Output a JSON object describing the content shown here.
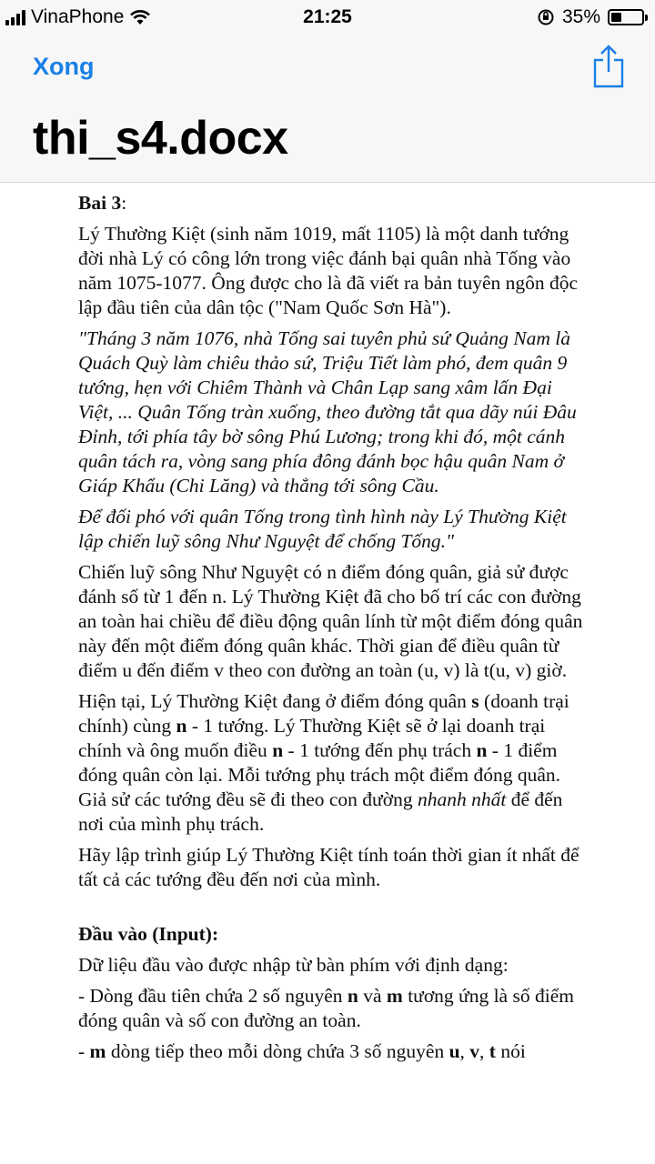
{
  "status_bar": {
    "carrier": "VinaPhone",
    "time": "21:25",
    "battery": "35%",
    "battery_level": 0.35
  },
  "nav": {
    "done_label": "Xong",
    "title": "thi_s4.docx"
  },
  "document": {
    "heading": "Bai 3",
    "heading_suffix": ":",
    "intro": "Lý Thường Kiệt (sinh năm 1019, mất 1105) là một danh tướng đời nhà Lý có công lớn trong việc đánh bại quân nhà Tống vào năm 1075-1077. Ông được cho là đã viết ra bản tuyên ngôn độc lập đầu tiên của dân tộc (\"Nam Quốc Sơn Hà\").",
    "quote1": "\"Tháng 3 năm 1076, nhà Tống sai tuyên phủ sứ Quảng Nam là Quách Quỳ làm chiêu thảo sứ, Triệu Tiết làm phó, đem quân 9 tướng, hẹn với Chiêm Thành và Chân Lạp sang xâm lấn Đại Việt, ... Quân Tống tràn xuống, theo đường tắt qua dãy núi Đâu Đỉnh, tới phía tây bờ sông Phú Lương; trong khi đó, một cánh quân tách ra, vòng sang phía đông đánh bọc hậu quân Nam ở Giáp Khẩu (Chi Lăng) và thẳng tới sông Cầu.",
    "quote2": "Để đối phó với quân Tống trong tình hình này Lý Thường Kiệt lập chiến luỹ sông Như Nguyệt để chống Tống.\"",
    "para_roads": "Chiến luỹ sông Như Nguyệt có n điểm đóng quân, giả sử được đánh số từ 1 đến n. Lý Thường Kiệt đã cho bố trí các con đường an toàn hai chiều để điều động quân lính từ một điểm đóng quân này đến một điểm đóng quân khác. Thời gian để điều quân từ điểm u đến điểm v theo con đường an toàn (u, v) là t(u, v) giờ.",
    "para_generals": {
      "t1": "Hiện tại, Lý Thường Kiệt đang ở điểm đóng quân ",
      "b1": "s",
      "t2": " (doanh trại chính) cùng ",
      "b2": "n",
      "t3": " - 1 tướng. Lý Thường Kiệt sẽ ở lại doanh trại chính và ông muốn điều ",
      "b3": "n",
      "t4": " - 1 tướng đến phụ trách ",
      "b4": "n",
      "t5": " - 1 điểm đóng quân còn lại. Mỗi tướng phụ trách một điểm đóng quân. Giả sử các tướng đều sẽ đi theo con đường ",
      "i1": "nhanh nhất",
      "t6": " để đến nơi của mình phụ trách."
    },
    "para_task": "Hãy lập trình giúp Lý Thường Kiệt tính toán thời gian ít nhất để tất cả các tướng đều đến nơi của mình.",
    "input_heading": "Đầu vào (Input):",
    "input_desc": "Dữ liệu đầu vào được nhập từ bàn phím với định dạng:",
    "input_line1": {
      "t1": "- Dòng đầu tiên chứa 2 số nguyên ",
      "b1": "n",
      "t2": " và ",
      "b2": "m",
      "t3": " tương ứng là số điểm đóng quân và số con đường an toàn."
    },
    "input_line2": {
      "t1": "- ",
      "b1": "m",
      "t2": " dòng tiếp theo mỗi dòng chứa 3 số nguyên ",
      "b2": "u",
      "t3": ", ",
      "b3": "v",
      "t4": ", ",
      "b4": "t",
      "t5": " nói"
    }
  }
}
